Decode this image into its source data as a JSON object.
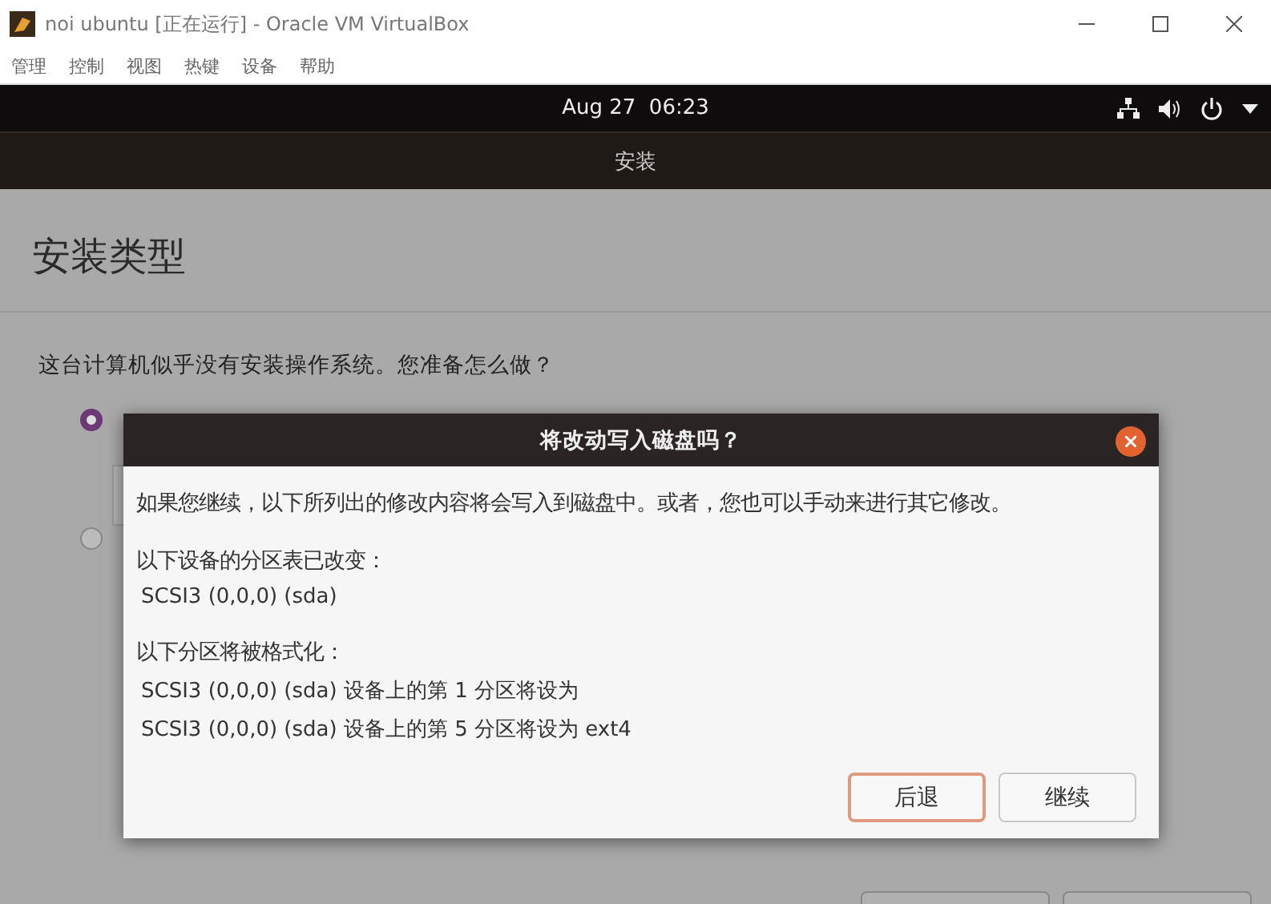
{
  "window": {
    "title": "noi ubuntu [正在运行] - Oracle VM VirtualBox"
  },
  "menu": [
    "管理",
    "控制",
    "视图",
    "热键",
    "设备",
    "帮助"
  ],
  "top_bar": {
    "clock": "Aug 27  06:23"
  },
  "header": {
    "title": "安装"
  },
  "page": {
    "heading": "安装类型",
    "question": "这台计算机似乎没有安装操作系统。您准备怎么做？",
    "options": [
      {
        "selected": true
      },
      {
        "selected": false
      }
    ]
  },
  "dialog": {
    "title": "将改动写入磁盘吗？",
    "intro": "如果您继续，以下所列出的修改内容将会写入到磁盘中。或者，您也可以手动来进行其它修改。",
    "sections": [
      {
        "heading": "以下设备的分区表已改变：",
        "items": [
          "SCSI3 (0,0,0) (sda)"
        ]
      },
      {
        "heading": "以下分区将被格式化：",
        "items": [
          "SCSI3 (0,0,0) (sda) 设备上的第 1 分区将设为",
          "SCSI3 (0,0,0) (sda) 设备上的第 5 分区将设为 ext4"
        ]
      }
    ],
    "buttons": [
      {
        "label": "后退",
        "focused": true
      },
      {
        "label": "继续",
        "focused": false
      }
    ]
  }
}
